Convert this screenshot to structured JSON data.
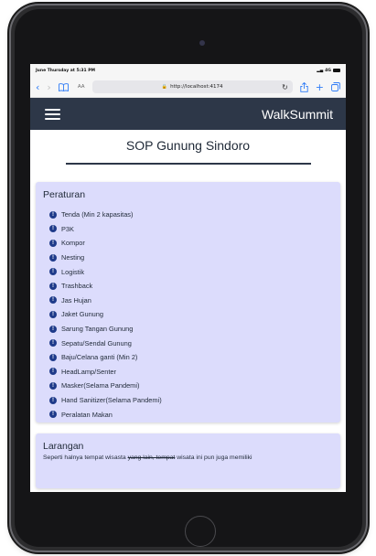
{
  "status_bar": {
    "time": "June Thursday at 5:31 PM",
    "network": "4G"
  },
  "browser": {
    "text_size_label": "AA",
    "url": "http://localhost:4174"
  },
  "app": {
    "brand": "WalkSummit"
  },
  "page": {
    "title": "SOP Gunung Sindoro"
  },
  "peraturan": {
    "heading": "Peraturan",
    "items": [
      "Tenda (Min 2 kapasitas)",
      "P3K",
      "Kompor",
      "Nesting",
      "Logistik",
      "Trashback",
      "Jas Hujan",
      "Jaket Gunung",
      "Sarung Tangan Gunung",
      "Sepatu/Sendal Gunung",
      "Baju/Celana ganti (Min 2)",
      "HeadLamp/Senter",
      "Masker(Selama Pandemi)",
      "Hand Sanitizer(Selama Pandemi)",
      "Peralatan Makan"
    ]
  },
  "larangan": {
    "heading": "Larangan",
    "text_before": "Seperti halnya tempat wisasta ",
    "text_struck": "yang lain, tempat",
    "text_after": " wisata ini pun juga memiliki"
  },
  "colors": {
    "navbar": "#2d3748",
    "card": "#dcdcfc",
    "icon": "#1e3a8a"
  }
}
